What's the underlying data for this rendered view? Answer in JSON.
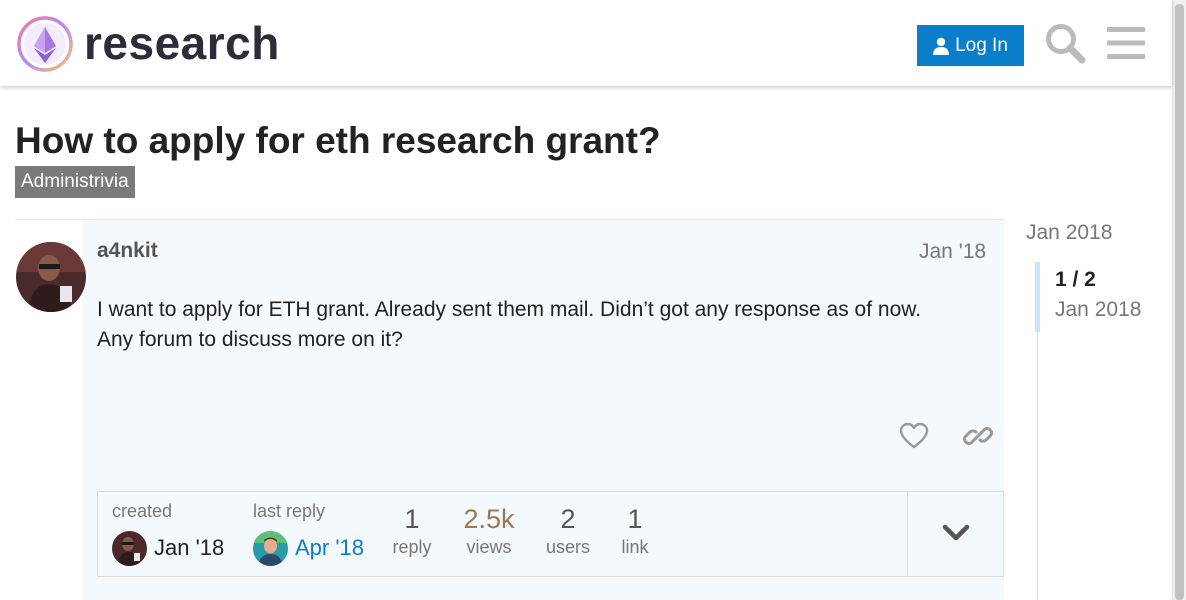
{
  "header": {
    "site_name": "research",
    "login_label": "Log In"
  },
  "topic": {
    "title": "How to apply for eth research grant?",
    "category": "Administrivia"
  },
  "post": {
    "username": "a4nkit",
    "date": "Jan '18",
    "body_line1": "I want to apply for ETH grant. Already sent them mail. Didn’t got any response as of now.",
    "body_line2": "Any forum to discuss more on it?"
  },
  "topic_map": {
    "created_label": "created",
    "created_date": "Jan '18",
    "last_reply_label": "last reply",
    "last_reply_date": "Apr '18",
    "stats": [
      {
        "num": "1",
        "label": "reply"
      },
      {
        "num": "2.5k",
        "label": "views"
      },
      {
        "num": "2",
        "label": "users"
      },
      {
        "num": "1",
        "label": "link"
      }
    ]
  },
  "timeline": {
    "start_label": "Jan 2018",
    "position": "1 / 2",
    "current_date": "Jan 2018"
  },
  "colors": {
    "accent": "#0a7ecb",
    "views_highlight": "#9a7a55",
    "category_bg": "#7a7a7a",
    "post_bg": "#f3f9fd"
  }
}
